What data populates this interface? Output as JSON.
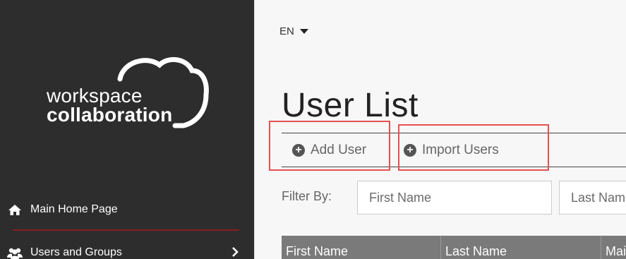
{
  "sidebar": {
    "logo": {
      "line1": "workspace",
      "line2": "collaboration"
    },
    "nav": [
      {
        "label": "Main Home Page",
        "icon": "home-icon"
      },
      {
        "label": "Users and Groups",
        "icon": "users-icon",
        "has_submenu": true
      }
    ]
  },
  "header": {
    "language": "EN"
  },
  "main": {
    "title": "User List",
    "actions": [
      {
        "label": "Add User",
        "icon": "plus-circle-icon"
      },
      {
        "label": "Import Users",
        "icon": "plus-circle-icon"
      }
    ],
    "filter": {
      "label": "Filter By:",
      "first_name_placeholder": "First Name",
      "last_name_placeholder": "Last Name"
    },
    "table": {
      "columns": [
        "First Name",
        "Last Name",
        "Mail"
      ]
    }
  },
  "colors": {
    "sidebar_bg": "#2d2d2d",
    "accent_divider": "#8b1c1f",
    "highlight": "#e55050",
    "table_header_bg": "#7a7a7a"
  }
}
